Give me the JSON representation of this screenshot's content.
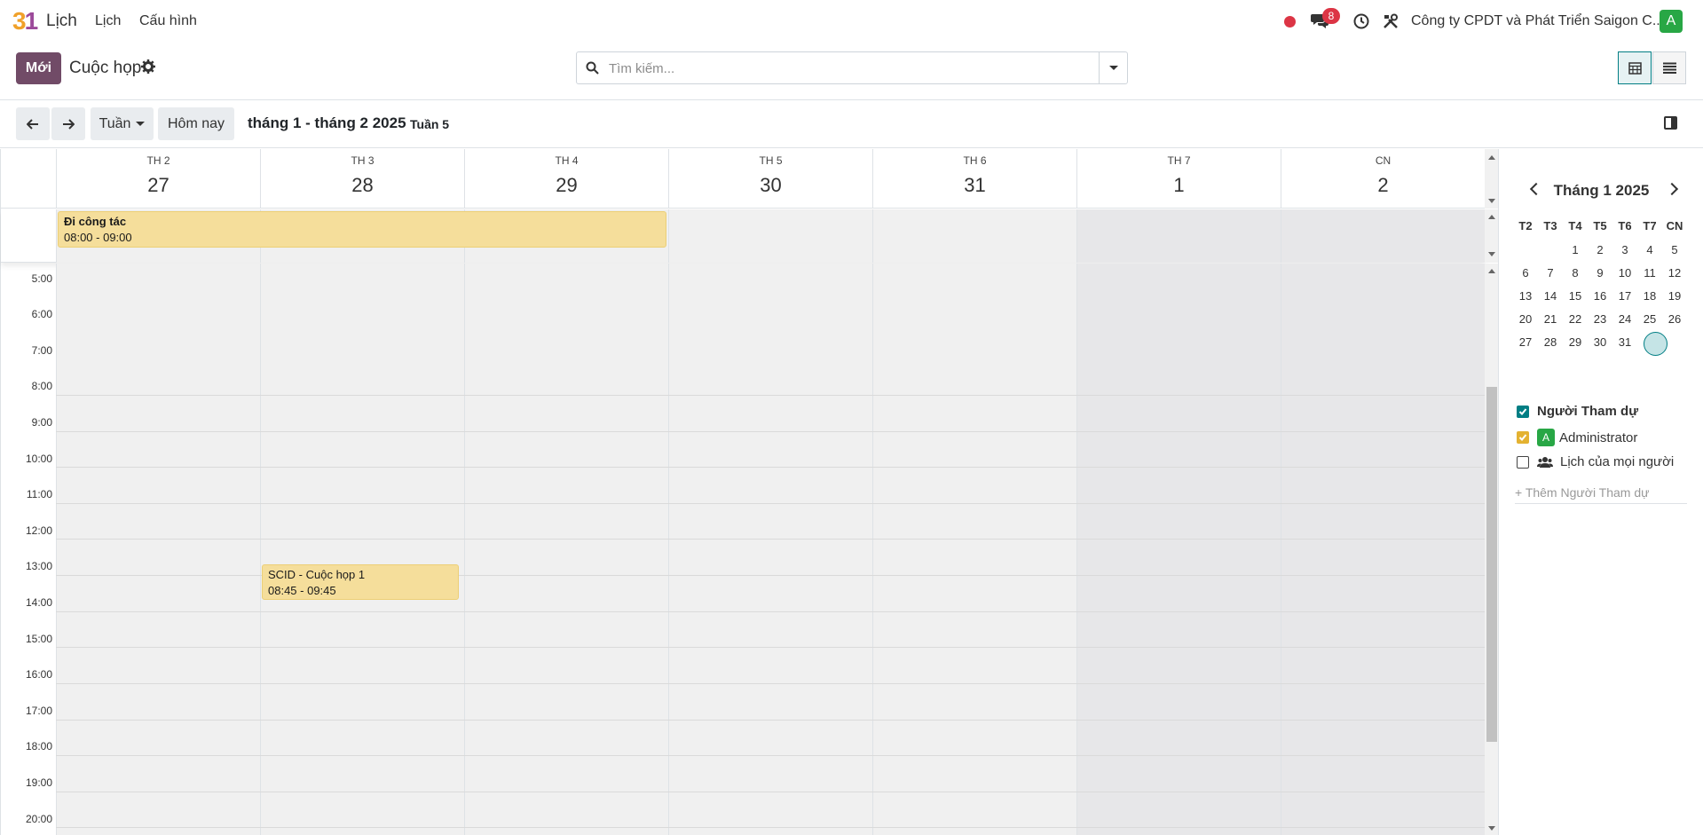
{
  "app": {
    "logo_text": "31",
    "name": "Lịch",
    "menu": [
      "Lịch",
      "Cấu hình"
    ]
  },
  "topbar": {
    "notifications_count": "8",
    "company": "Công ty CPDT và Phát Triển Saigon C...",
    "avatar_initial": "A",
    "icons": [
      "record-icon",
      "chat-icon",
      "clock-icon",
      "tools-icon"
    ]
  },
  "control": {
    "new_label": "Mới",
    "breadcrumb": "Cuộc họp",
    "search_placeholder": "Tìm kiếm...",
    "views": [
      "calendar-view",
      "list-view"
    ],
    "active_view": "calendar-view"
  },
  "toolbar": {
    "scale_label": "Tuần",
    "today_label": "Hôm nay",
    "range_label": "tháng 1 - tháng 2 2025",
    "week_label": "Tuần 5"
  },
  "week": {
    "days": [
      {
        "name": "TH 2",
        "date": "27"
      },
      {
        "name": "TH 3",
        "date": "28"
      },
      {
        "name": "TH 4",
        "date": "29"
      },
      {
        "name": "TH 5",
        "date": "30"
      },
      {
        "name": "TH 6",
        "date": "31"
      },
      {
        "name": "TH 7",
        "date": "1"
      },
      {
        "name": "CN",
        "date": "2"
      }
    ],
    "hours": [
      "5:00",
      "6:00",
      "7:00",
      "8:00",
      "9:00",
      "10:00",
      "11:00",
      "12:00",
      "13:00",
      "14:00",
      "15:00",
      "16:00",
      "17:00",
      "18:00",
      "19:00",
      "20:00"
    ]
  },
  "events": [
    {
      "title": "Đi công tác",
      "time": "08:00 - 09:00",
      "all_day": true,
      "start_day": "TH 2",
      "end_day": "TH 4"
    },
    {
      "title": "SCID - Cuộc họp 1",
      "time": "08:45 - 09:45",
      "all_day": false,
      "day": "TH 3"
    }
  ],
  "mini_calendar": {
    "title": "Tháng 1 2025",
    "weekdays": [
      "T2",
      "T3",
      "T4",
      "T5",
      "T6",
      "T7",
      "CN"
    ],
    "weeks": [
      [
        "",
        "",
        "1",
        "2",
        "3",
        "4",
        "5"
      ],
      [
        "6",
        "7",
        "8",
        "9",
        "10",
        "11",
        "12"
      ],
      [
        "13",
        "14",
        "15",
        "16",
        "17",
        "18",
        "19"
      ],
      [
        "20",
        "21",
        "22",
        "23",
        "24",
        "25",
        "26"
      ],
      [
        "27",
        "28",
        "29",
        "30",
        "31",
        "",
        ""
      ]
    ],
    "today": "31"
  },
  "filters": {
    "section_label": "Người Tham dự",
    "items": [
      {
        "label": "Administrator",
        "avatar": "A",
        "checked": true
      },
      {
        "label": "Lịch của mọi người",
        "checked": false
      }
    ],
    "add_label": "+ Thêm Người Tham dự"
  },
  "colors": {
    "primary": "#714b67",
    "accent": "#017e84",
    "event_bg": "#f5de9b",
    "badge": "#dc3545",
    "avatar": "#28a745"
  }
}
